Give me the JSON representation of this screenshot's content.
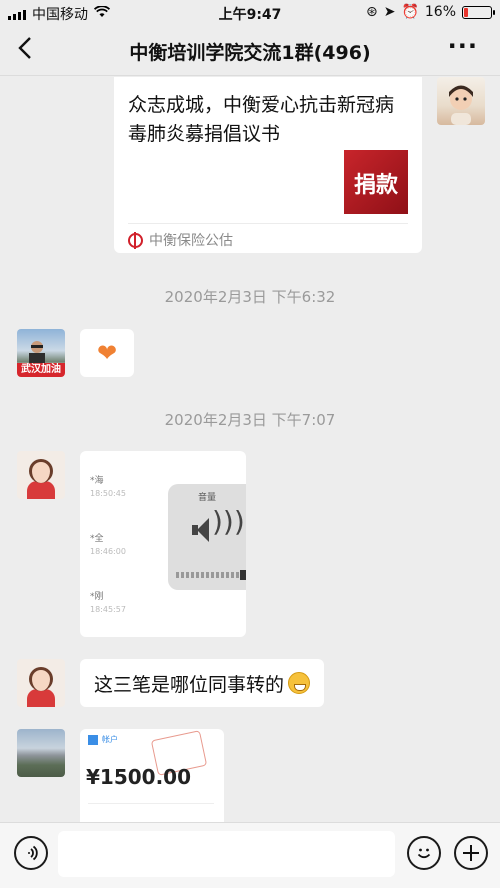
{
  "status_bar": {
    "carrier": "中国移动",
    "time": "上午9:47",
    "battery": "16%",
    "battery_level": 0.16
  },
  "nav": {
    "back_icon": "chevron-left-icon",
    "title": "中衡培训学院交流1群(496)",
    "more_icon": "ellipsis-icon"
  },
  "messages": {
    "article": {
      "title": "众志成城，中衡爱心抗击新冠病毒肺炎募捐倡议书",
      "thumb_text": "捐款",
      "source": "中衡保险公估"
    },
    "timestamp_1": "2020年2月3日 下午6:32",
    "heart": "❤",
    "avatar_banner": "武汉加油",
    "timestamp_2": "2020年2月3日 下午7:07",
    "screenshot": {
      "rows": [
        {
          "name": "*海",
          "time": "18:50:45"
        },
        {
          "name": "*全",
          "time": "18:46:00"
        },
        {
          "name": "*刚",
          "time": "18:45:57"
        }
      ],
      "volume_label": "音量"
    },
    "question": "这三笔是哪位同事转的",
    "receipt": {
      "brand": "帐户",
      "amount": "¥1500.00"
    }
  },
  "input_bar": {
    "voice_icon": "voice-icon",
    "emoji_icon": "emoji-icon",
    "plus_icon": "plus-icon",
    "value": ""
  }
}
